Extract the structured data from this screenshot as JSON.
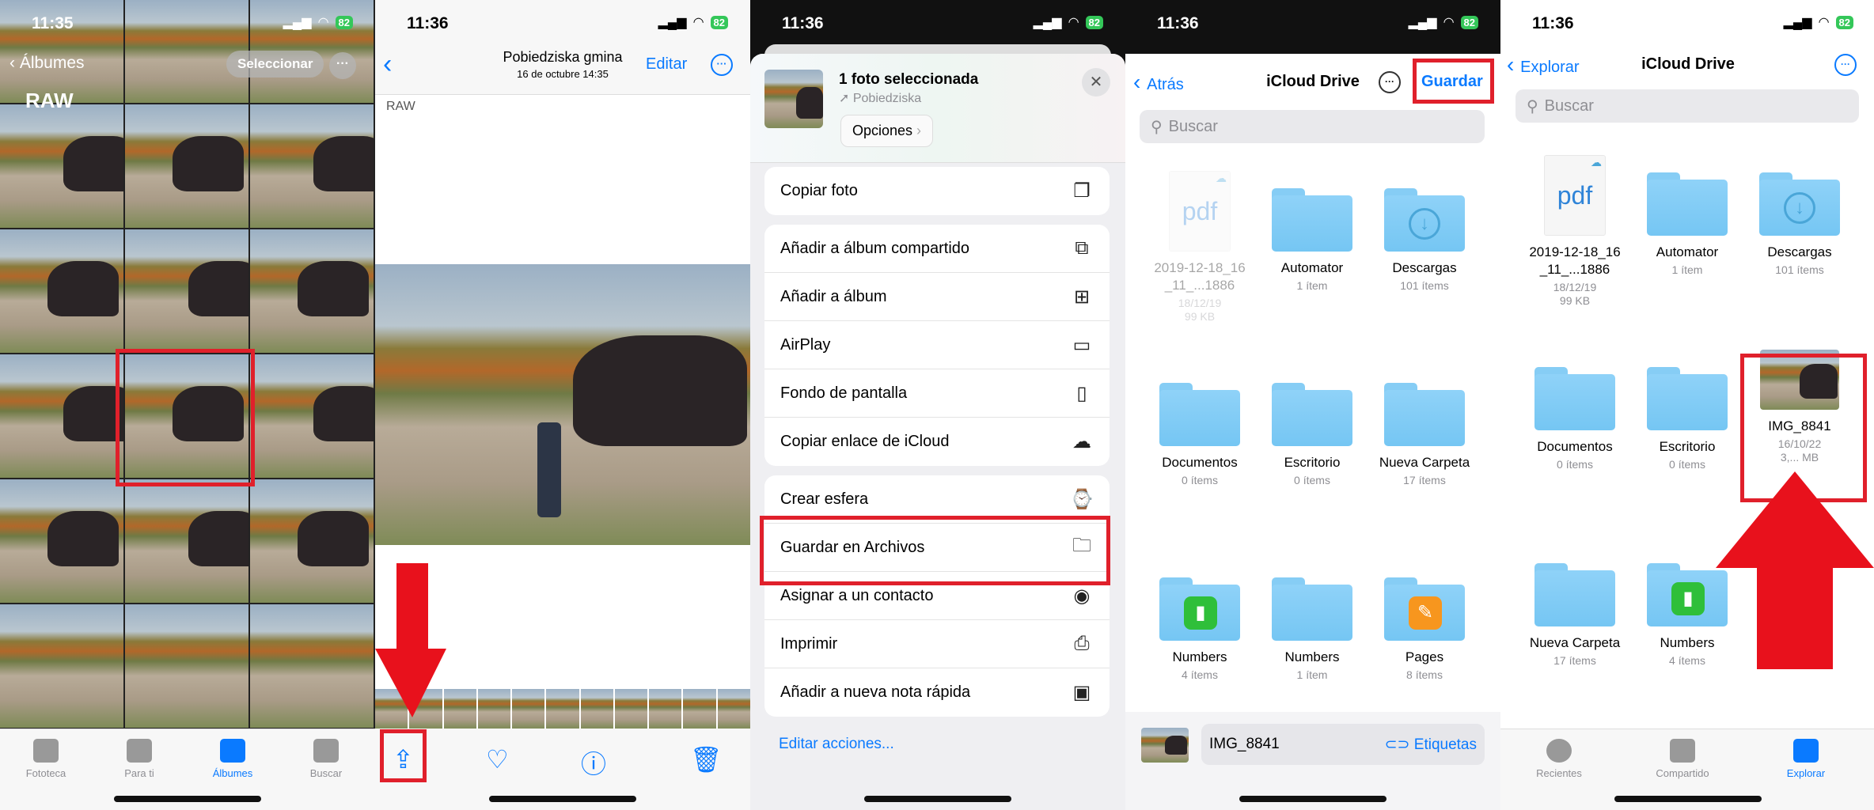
{
  "colors": {
    "accent": "#0a7aff",
    "highlight": "#e0202b",
    "battery": "#34c759",
    "folder": "#7fcaf5"
  },
  "panel1": {
    "time": "11:35",
    "battery": "82",
    "back_label": "Álbumes",
    "select_label": "Seleccionar",
    "album_title": "RAW",
    "tabs": [
      {
        "label": "Fototeca",
        "icon": "photo-library-icon"
      },
      {
        "label": "Para ti",
        "icon": "for-you-icon"
      },
      {
        "label": "Álbumes",
        "icon": "albums-icon",
        "active": true
      },
      {
        "label": "Buscar",
        "icon": "search-icon"
      }
    ]
  },
  "panel2": {
    "time": "11:36",
    "battery": "82",
    "title": "Pobiedziska gmina",
    "subtitle": "16 de octubre  14:35",
    "edit_label": "Editar",
    "album_label": "RAW",
    "toolbar": [
      {
        "icon": "share-icon",
        "glyph": "⇪"
      },
      {
        "icon": "heart-icon",
        "glyph": "♡"
      },
      {
        "icon": "info-icon",
        "glyph": "ⓘ"
      },
      {
        "icon": "trash-icon",
        "glyph": "🗑"
      }
    ]
  },
  "panel3": {
    "time": "11:36",
    "battery": "82",
    "header_title": "1 foto seleccionada",
    "location": "Pobiedziska",
    "options_label": "Opciones",
    "groups": [
      [
        {
          "label": "Copiar foto",
          "icon": "copy-icon",
          "glyph": "❐"
        }
      ],
      [
        {
          "label": "Añadir a álbum compartido",
          "icon": "shared-album-icon",
          "glyph": "⧉"
        },
        {
          "label": "Añadir a álbum",
          "icon": "add-album-icon",
          "glyph": "⊞"
        },
        {
          "label": "AirPlay",
          "icon": "airplay-icon",
          "glyph": "▭"
        },
        {
          "label": "Fondo de pantalla",
          "icon": "phone-icon",
          "glyph": "▯"
        },
        {
          "label": "Copiar enlace de iCloud",
          "icon": "cloud-link-icon",
          "glyph": "☁"
        }
      ],
      [
        {
          "label": "Crear esfera",
          "icon": "watch-icon",
          "glyph": "⌚"
        },
        {
          "label": "Guardar en Archivos",
          "icon": "folder-icon",
          "glyph": "🗀"
        },
        {
          "label": "Asignar a un contacto",
          "icon": "contact-icon",
          "glyph": "◉"
        },
        {
          "label": "Imprimir",
          "icon": "printer-icon",
          "glyph": "⎙"
        },
        {
          "label": "Añadir a nueva nota rápida",
          "icon": "quick-note-icon",
          "glyph": "▣"
        }
      ]
    ],
    "edit_actions_label": "Editar acciones..."
  },
  "panel4": {
    "time": "11:36",
    "battery": "82",
    "back_label": "Atrás",
    "title": "iCloud Drive",
    "save_label": "Guardar",
    "search_placeholder": "Buscar",
    "items": [
      {
        "type": "pdf",
        "name": "2019-12-18_16_11_...1886",
        "date": "18/12/19",
        "size": "99 KB",
        "dimmed": true
      },
      {
        "type": "folder",
        "name": "Automator",
        "count": "1 ítem"
      },
      {
        "type": "folder",
        "name": "Descargas",
        "count": "101 ítems",
        "glyph": "↓"
      },
      {
        "type": "folder",
        "name": "Documentos",
        "count": "0 ítems"
      },
      {
        "type": "folder",
        "name": "Escritorio",
        "count": "0 ítems"
      },
      {
        "type": "folder",
        "name": "Nueva Carpeta",
        "count": "17 ítems"
      },
      {
        "type": "folder",
        "name": "Numbers",
        "count": "4 ítems",
        "app": "numbers"
      },
      {
        "type": "folder",
        "name": "Numbers",
        "count": "1 ítem"
      },
      {
        "type": "folder",
        "name": "Pages",
        "count": "8 ítems",
        "app": "pages"
      }
    ],
    "filename": "IMG_8841",
    "tags_label": "Etiquetas"
  },
  "panel5": {
    "time": "11:36",
    "battery": "82",
    "back_label": "Explorar",
    "title": "iCloud Drive",
    "search_placeholder": "Buscar",
    "items": [
      {
        "type": "pdf",
        "name": "2019-12-18_16_11_...1886",
        "date": "18/12/19",
        "size": "99 KB"
      },
      {
        "type": "folder",
        "name": "Automator",
        "count": "1 ítem"
      },
      {
        "type": "folder",
        "name": "Descargas",
        "count": "101 ítems",
        "glyph": "↓"
      },
      {
        "type": "folder",
        "name": "Documentos",
        "count": "0 ítems"
      },
      {
        "type": "folder",
        "name": "Escritorio",
        "count": "0 ítems"
      },
      {
        "type": "image",
        "name": "IMG_8841",
        "date": "16/10/22",
        "size": "3,... MB"
      },
      {
        "type": "folder",
        "name": "Nueva Carpeta",
        "count": "17 ítems"
      },
      {
        "type": "folder",
        "name": "Numbers",
        "count": "4 ítems",
        "app": "numbers"
      }
    ],
    "tabs": [
      {
        "label": "Recientes",
        "icon": "clock-icon"
      },
      {
        "label": "Compartido",
        "icon": "shared-folder-icon"
      },
      {
        "label": "Explorar",
        "icon": "browse-folder-icon",
        "active": true
      }
    ]
  }
}
